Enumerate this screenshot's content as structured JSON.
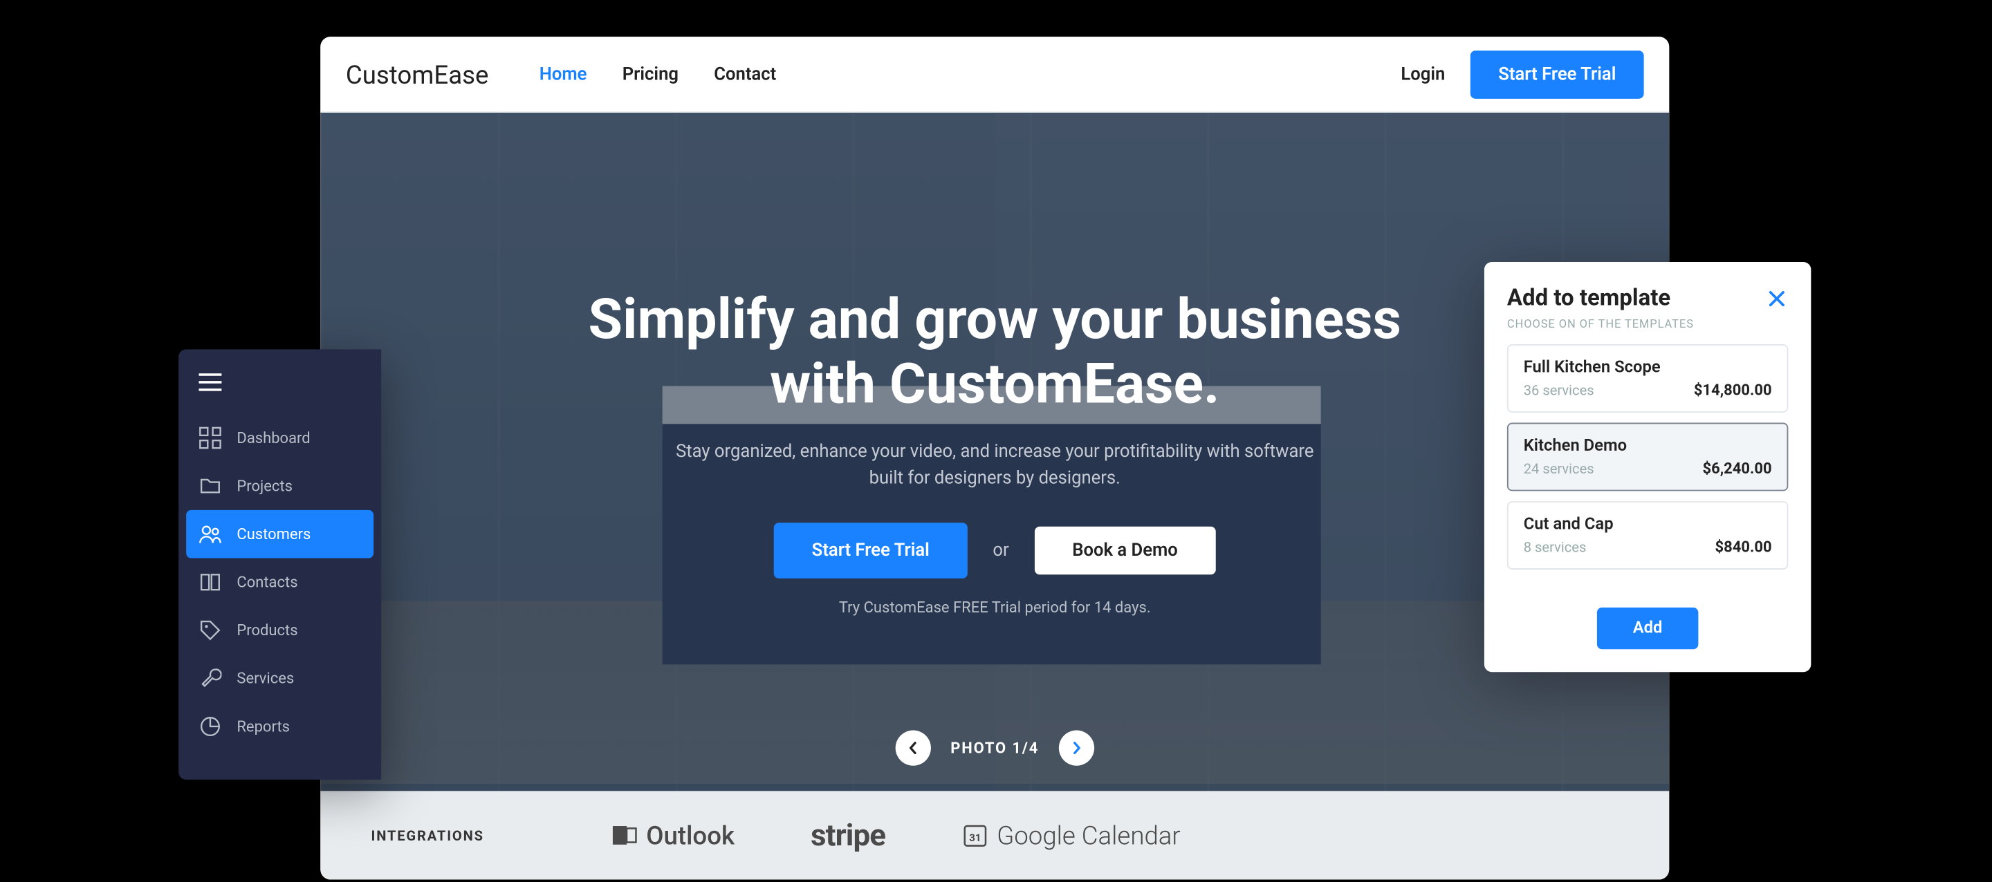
{
  "nav": {
    "brand": "CustomEase",
    "links": [
      {
        "label": "Home",
        "active": true
      },
      {
        "label": "Pricing",
        "active": false
      },
      {
        "label": "Contact",
        "active": false
      }
    ],
    "login": "Login",
    "cta": "Start Free Trial"
  },
  "hero": {
    "title": "Simplify and grow your business with CustomEase.",
    "subtitle": "Stay organized, enhance your video, and increase your protifitability with software built for designers by designers.",
    "primary_cta": "Start Free Trial",
    "or": "or",
    "secondary_cta": "Book a Demo",
    "trial_note": "Try CustomEase FREE Trial period for 14 days.",
    "photo_counter": "PHOTO 1/4"
  },
  "integrations": {
    "label": "INTEGRATIONS",
    "logos": [
      "Outlook",
      "stripe",
      "Google Calendar"
    ]
  },
  "sidebar": {
    "items": [
      {
        "label": "Dashboard",
        "icon": "grid"
      },
      {
        "label": "Projects",
        "icon": "folder"
      },
      {
        "label": "Customers",
        "icon": "users",
        "active": true
      },
      {
        "label": "Contacts",
        "icon": "book"
      },
      {
        "label": "Products",
        "icon": "tag"
      },
      {
        "label": "Services",
        "icon": "wrench"
      },
      {
        "label": "Reports",
        "icon": "pie"
      }
    ]
  },
  "template_card": {
    "title": "Add to template",
    "sublabel": "CHOOSE ON OF THE TEMPLATES",
    "items": [
      {
        "name": "Full Kitchen Scope",
        "services": "36 services",
        "price": "$14,800.00",
        "selected": false
      },
      {
        "name": "Kitchen Demo",
        "services": "24 services",
        "price": "$6,240.00",
        "selected": true
      },
      {
        "name": "Cut and Cap",
        "services": "8 services",
        "price": "$840.00",
        "selected": false
      }
    ],
    "add_label": "Add"
  },
  "colors": {
    "primary": "#1a82ff",
    "sidebar_bg": "#252a47"
  }
}
